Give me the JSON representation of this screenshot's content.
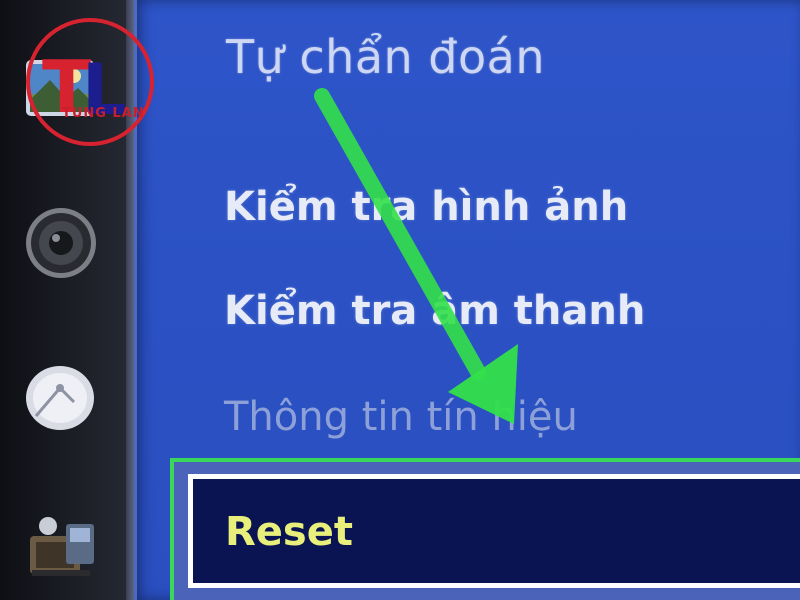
{
  "logo": {
    "letter_left": "T",
    "letter_right": "L",
    "caption": "TUNG LAN"
  },
  "menu": {
    "title": "Tự chẩn đoán",
    "items": [
      {
        "label": "Kiểm tra hình ảnh",
        "state": "enabled"
      },
      {
        "label": "Kiểm tra âm thanh",
        "state": "enabled"
      },
      {
        "label": "Thông tin tín hiệu",
        "state": "disabled"
      },
      {
        "label": "Reset",
        "state": "selected"
      }
    ]
  },
  "sidebar_icons": [
    "picture-icon",
    "sound-icon",
    "channel-icon",
    "support-icon"
  ],
  "colors": {
    "panel_blue": "#2b51c4",
    "highlight_green": "#3ad85a",
    "selected_text": "#e8ef7a",
    "logo_red": "#d7222f",
    "logo_blue": "#1c1d8f",
    "arrow_green": "#33e04a"
  }
}
